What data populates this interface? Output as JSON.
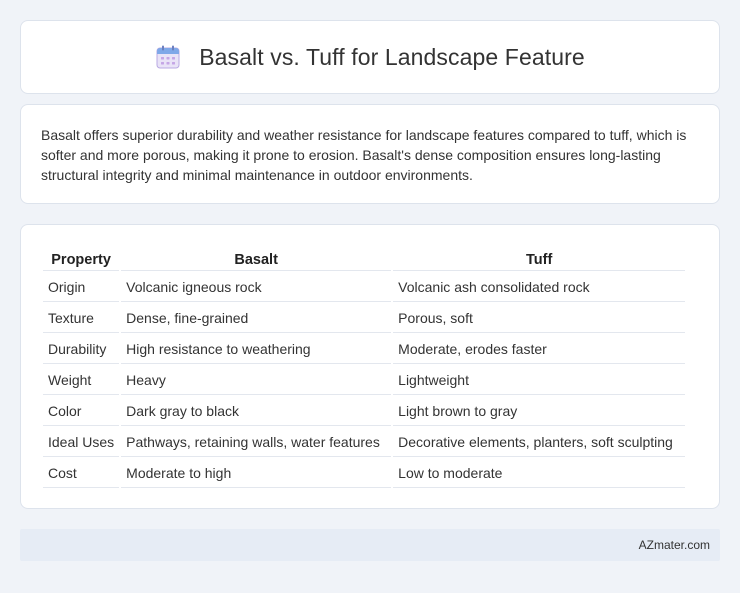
{
  "header": {
    "title": "Basalt vs. Tuff for Landscape Feature",
    "icon": "calendar-icon"
  },
  "summary": {
    "text": "Basalt offers superior durability and weather resistance for landscape features compared to tuff, which is softer and more porous, making it prone to erosion. Basalt's dense composition ensures long-lasting structural integrity and minimal maintenance in outdoor environments."
  },
  "table": {
    "headers": [
      "Property",
      "Basalt",
      "Tuff"
    ],
    "rows": [
      [
        "Origin",
        "Volcanic igneous rock",
        "Volcanic ash consolidated rock"
      ],
      [
        "Texture",
        "Dense, fine-grained",
        "Porous, soft"
      ],
      [
        "Durability",
        "High resistance to weathering",
        "Moderate, erodes faster"
      ],
      [
        "Weight",
        "Heavy",
        "Lightweight"
      ],
      [
        "Color",
        "Dark gray to black",
        "Light brown to gray"
      ],
      [
        "Ideal Uses",
        "Pathways, retaining walls, water features",
        "Decorative elements, planters, soft sculpting"
      ],
      [
        "Cost",
        "Moderate to high",
        "Low to moderate"
      ]
    ]
  },
  "footer": {
    "text": "AZmater.com"
  },
  "colors": {
    "background": "#f0f3f8",
    "card": "#ffffff",
    "footer": "#e6ecf5"
  }
}
